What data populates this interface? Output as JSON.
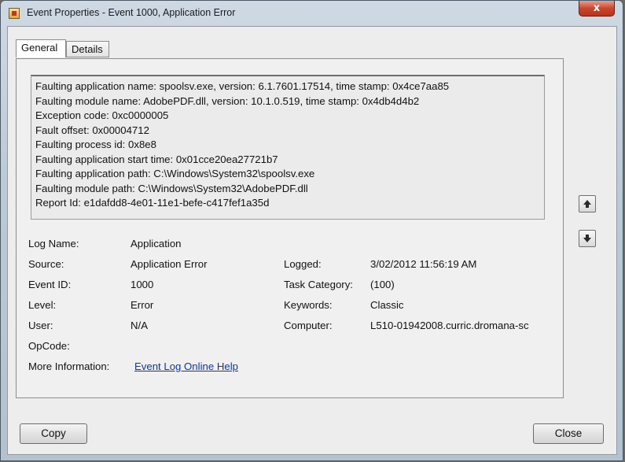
{
  "window": {
    "title": "Event Properties - Event 1000, Application Error",
    "close_glyph": "x"
  },
  "tabs": [
    {
      "label": "General",
      "active": true
    },
    {
      "label": "Details",
      "active": false
    }
  ],
  "description_lines": [
    "Faulting application name: spoolsv.exe, version: 6.1.7601.17514, time stamp: 0x4ce7aa85",
    "Faulting module name: AdobePDF.dll, version: 10.1.0.519, time stamp: 0x4db4d4b2",
    "Exception code: 0xc0000005",
    "Fault offset: 0x00004712",
    "Faulting process id: 0x8e8",
    "Faulting application start time: 0x01cce20ea27721b7",
    "Faulting application path: C:\\Windows\\System32\\spoolsv.exe",
    "Faulting module path: C:\\Windows\\System32\\AdobePDF.dll",
    "Report Id: e1dafdd8-4e01-11e1-befe-c417fef1a35d"
  ],
  "details": {
    "log_name": {
      "label": "Log Name:",
      "value": "Application"
    },
    "source": {
      "label": "Source:",
      "value": "Application Error"
    },
    "logged": {
      "label": "Logged:",
      "value": "3/02/2012 11:56:19 AM"
    },
    "event_id": {
      "label": "Event ID:",
      "value": "1000"
    },
    "task_category": {
      "label": "Task Category:",
      "value": "(100)"
    },
    "level": {
      "label": "Level:",
      "value": "Error"
    },
    "keywords": {
      "label": "Keywords:",
      "value": "Classic"
    },
    "user": {
      "label": "User:",
      "value": "N/A"
    },
    "computer": {
      "label": "Computer:",
      "value": "L510-01942008.curric.dromana-sc"
    },
    "opcode": {
      "label": "OpCode:",
      "value": ""
    },
    "more_info": {
      "label": "More Information:",
      "link": "Event Log Online Help"
    }
  },
  "buttons": {
    "copy": "Copy",
    "close": "Close"
  },
  "icons": {
    "title": "event-viewer-icon",
    "up": "arrow-up-icon",
    "down": "arrow-down-icon"
  }
}
